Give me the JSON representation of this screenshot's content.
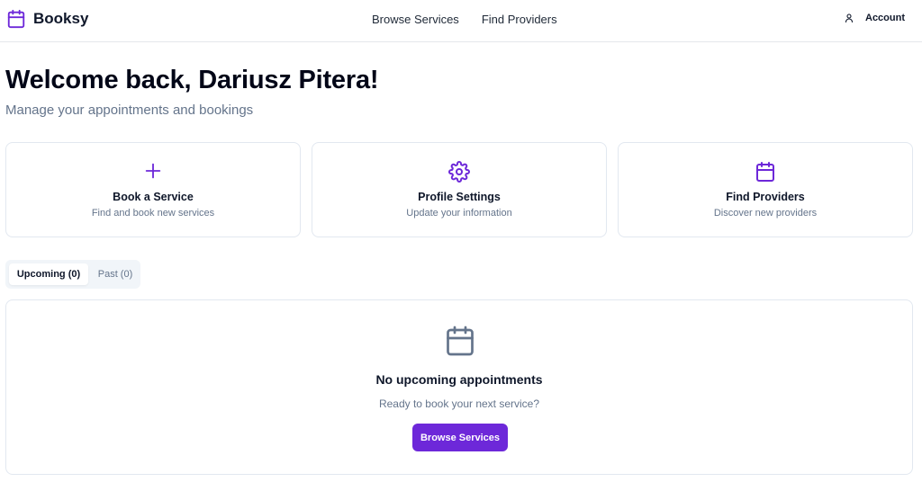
{
  "header": {
    "brand": "Booksy",
    "nav": [
      "Browse Services",
      "Find Providers"
    ],
    "account": "Account"
  },
  "welcome": {
    "title": "Welcome back, Dariusz Pitera!",
    "subtitle": "Manage your appointments and bookings"
  },
  "cards": [
    {
      "title": "Book a Service",
      "desc": "Find and book new services",
      "icon": "plus-icon"
    },
    {
      "title": "Profile Settings",
      "desc": "Update your information",
      "icon": "gear-icon"
    },
    {
      "title": "Find Providers",
      "desc": "Discover new providers",
      "icon": "calendar-icon"
    }
  ],
  "tabs": [
    {
      "label": "Upcoming (0)",
      "active": true
    },
    {
      "label": "Past (0)",
      "active": false
    }
  ],
  "empty_state": {
    "title": "No upcoming appointments",
    "desc": "Ready to book your next service?",
    "button": "Browse Services"
  },
  "colors": {
    "accent": "#6d28d9",
    "muted_text": "#64748b",
    "border": "#e2e8f0"
  }
}
